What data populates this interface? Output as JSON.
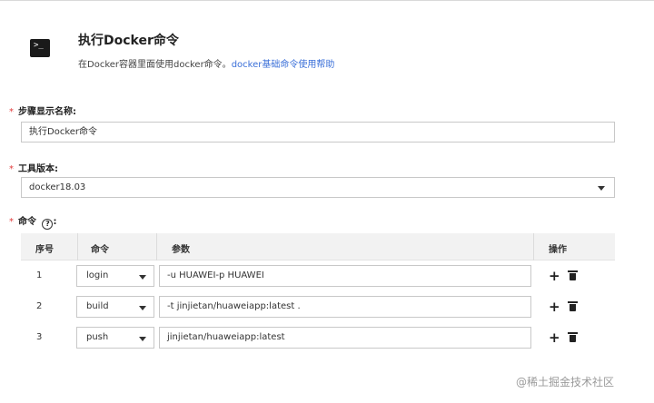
{
  "header": {
    "icon": "terminal-icon",
    "icon_glyph": ">_",
    "title": "执行Docker命令",
    "desc": "在Docker容器里面使用docker命令。",
    "help_link": "docker基础命令使用帮助"
  },
  "fields": {
    "step_name": {
      "label": "步骤显示名称:",
      "value": "执行Docker命令"
    },
    "tool_version": {
      "label": "工具版本:",
      "value": "docker18.03"
    },
    "commands": {
      "label": "命令",
      "help_icon": "question-circle-icon",
      "help_glyph": "?",
      "colon": ":"
    }
  },
  "required_mark": "*",
  "table": {
    "columns": [
      "序号",
      "命令",
      "参数",
      "操作"
    ],
    "rows": [
      {
        "num": "1",
        "cmd": "login",
        "args": "-u HUAWEI-p HUAWEI"
      },
      {
        "num": "2",
        "cmd": "build",
        "args": "-t jinjietan/huaweiapp:latest ."
      },
      {
        "num": "3",
        "cmd": "push",
        "args": "jinjietan/huaweiapp:latest"
      }
    ],
    "add_glyph": "+"
  },
  "watermark": "@稀土掘金技术社区",
  "colors": {
    "accent_link": "#3a6fd8",
    "required": "#e23c3c"
  }
}
